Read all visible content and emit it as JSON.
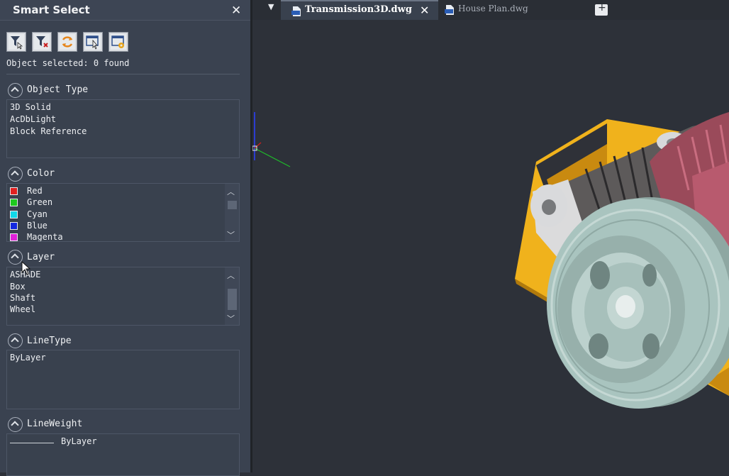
{
  "panel": {
    "title": "Smart Select",
    "close": "✕",
    "status": "Object selected: 0 found"
  },
  "toolbar": [
    {
      "icon": "filter-select-icon"
    },
    {
      "icon": "filter-deselect-icon"
    },
    {
      "icon": "refresh-icon"
    },
    {
      "icon": "select-objects-icon"
    },
    {
      "icon": "settings-icon"
    }
  ],
  "sections": {
    "object_type": {
      "label": "Object Type",
      "items": [
        "3D Solid",
        "AcDbLight",
        "Block Reference"
      ]
    },
    "color": {
      "label": "Color",
      "items": [
        {
          "name": "Red",
          "hex": "#e02020"
        },
        {
          "name": "Green",
          "hex": "#1ec81e"
        },
        {
          "name": "Cyan",
          "hex": "#10d8e8"
        },
        {
          "name": "Blue",
          "hex": "#1428e0"
        },
        {
          "name": "Magenta",
          "hex": "#e020d8"
        }
      ]
    },
    "layer": {
      "label": "Layer",
      "items": [
        "ASHADE",
        "Box",
        "Shaft",
        "Wheel"
      ]
    },
    "linetype": {
      "label": "LineType",
      "items": [
        "ByLayer"
      ]
    },
    "lineweight": {
      "label": "LineWeight",
      "items": [
        "ByLayer"
      ]
    }
  },
  "tabs": [
    {
      "label": "Transmission3D.dwg",
      "active": true
    },
    {
      "label": "House Plan.dwg",
      "active": false
    }
  ],
  "tab_close": "✕",
  "dropdown": "▼",
  "colors": {
    "panel_bg": "#3a4250",
    "viewport_bg": "#2d3139",
    "box_yellow": "#f2b41c",
    "gear_red": "#9a4a5a",
    "wheel": "#a9c4bf"
  }
}
